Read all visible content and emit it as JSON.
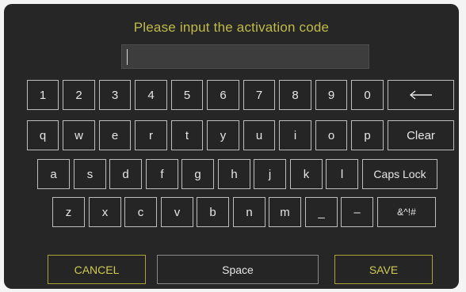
{
  "dialog": {
    "title": "Please input the activation code"
  },
  "code_input": {
    "value": ""
  },
  "keyboard": {
    "row1": [
      "1",
      "2",
      "3",
      "4",
      "5",
      "6",
      "7",
      "8",
      "9",
      "0"
    ],
    "backspace_icon": "left-arrow-icon",
    "row2": [
      "q",
      "w",
      "e",
      "r",
      "t",
      "y",
      "u",
      "i",
      "o",
      "p"
    ],
    "clear_label": "Clear",
    "row3": [
      "a",
      "s",
      "d",
      "f",
      "g",
      "h",
      "j",
      "k",
      "l"
    ],
    "caps_label": "Caps Lock",
    "row4": [
      "z",
      "x",
      "c",
      "v",
      "b",
      "n",
      "m",
      "_",
      "–"
    ],
    "symbols_label": "&^!#"
  },
  "actions": {
    "cancel_label": "CANCEL",
    "space_label": "Space",
    "save_label": "SAVE"
  },
  "colors": {
    "accent": "#c0bb4a",
    "panel_bg": "#262626",
    "key_border": "#bdbdbd"
  }
}
